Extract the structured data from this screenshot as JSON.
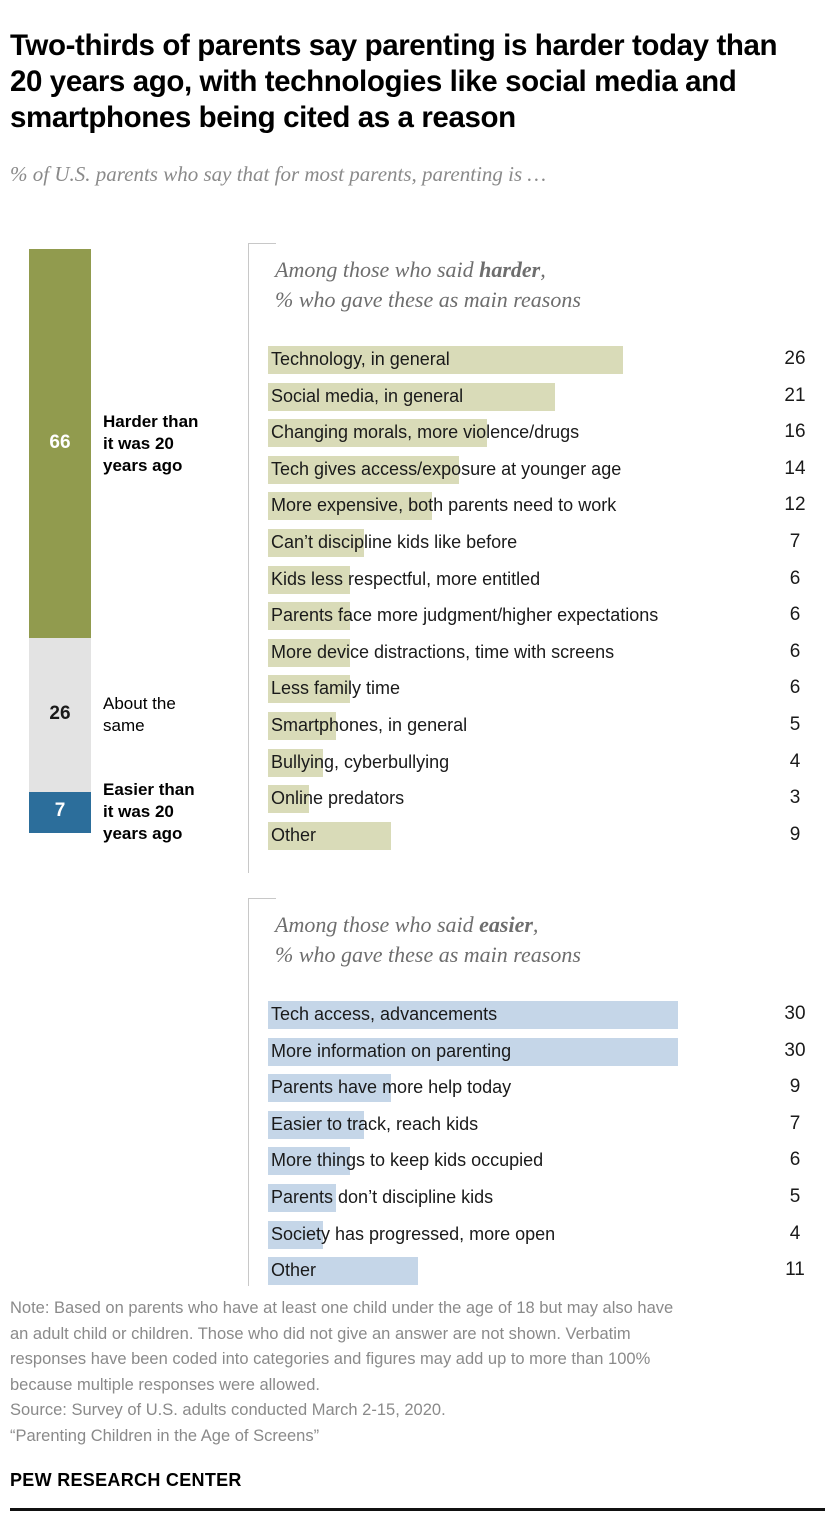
{
  "header": {
    "title": "Two-thirds of parents say parenting is harder today than 20 years ago, with technologies like social media and smartphones being cited as a reason",
    "subtitle": "% of U.S. parents who say that for most parents, parenting is …"
  },
  "footer": {
    "note_line1": "Note: Based on parents who have at least one child under the age of 18 but may also have",
    "note_line2": "an adult child or children. Those who did not give an answer are not shown. Verbatim",
    "note_line3": "responses have been coded into categories and figures may add up to more than 100%",
    "note_line4": "because multiple responses were allowed.",
    "source": "Source: Survey of U.S. adults conducted March 2-15, 2020.",
    "report": "“Parenting Children in the Age of Screens”",
    "org": "PEW RESEARCH CENTER"
  },
  "colors": {
    "harder": "#919b4e",
    "harder_light": "#d9dbb8",
    "same": "#e3e3e3",
    "easier": "#2c6e9b",
    "easier_light": "#c5d6e8",
    "note_text": "#8a8a8a"
  },
  "panels": {
    "harder_head_line1_pre": "Among those who said ",
    "harder_head_line1_bold": "harder",
    "harder_head_line1_post": ",",
    "harder_head_line2": "% who gave these as main reasons",
    "easier_head_line1_pre": "Among those who said ",
    "easier_head_line1_bold": "easier",
    "easier_head_line1_post": ",",
    "easier_head_line2": "% who gave these as main reasons"
  },
  "chart_data": {
    "type": "bar",
    "title": "Two-thirds of parents say parenting is harder today than 20 years ago, with technologies like social media and smartphones being cited as a reason",
    "subtitle": "% of U.S. parents who say that for most parents, parenting is …",
    "xlabel": "",
    "ylabel": "",
    "grid": false,
    "legend": "none",
    "stacked_bar": {
      "type": "bar",
      "orientation": "vertical-stacked",
      "categories": [
        "Harder than it was 20 years ago",
        "About the same",
        "Easier than it was 20 years ago"
      ],
      "values": [
        66,
        26,
        7
      ],
      "colors": [
        "#919b4e",
        "#e3e3e3",
        "#2c6e9b"
      ],
      "labels": [
        {
          "value": "66",
          "line1": "Harder than",
          "line2": "it was 20",
          "line3": "years ago",
          "bold": true
        },
        {
          "value": "26",
          "line1": "About the",
          "line2": "same",
          "line3": "",
          "bold": false
        },
        {
          "value": "7",
          "line1": "Easier than",
          "line2": "it was 20",
          "line3": "years ago",
          "bold": true
        }
      ]
    },
    "harder_reasons": {
      "type": "bar",
      "orientation": "horizontal",
      "title": "Among those who said harder, % who gave these as main reasons",
      "categories": [
        "Technology, in general",
        "Social media, in general",
        "Changing morals, more violence/drugs",
        "Tech gives access/exposure at younger age",
        "More expensive, both parents need to work",
        "Can’t discipline kids like before",
        "Kids less respectful, more entitled",
        "Parents face more judgment/higher expectations",
        "More device distractions, time with screens",
        "Less family time",
        "Smartphones, in general",
        "Bullying, cyberbullying",
        "Online predators",
        "Other"
      ],
      "values": [
        26,
        21,
        16,
        14,
        12,
        7,
        6,
        6,
        6,
        6,
        5,
        4,
        3,
        9
      ],
      "xlim": [
        0,
        30
      ],
      "color": "#d9dbb8"
    },
    "easier_reasons": {
      "type": "bar",
      "orientation": "horizontal",
      "title": "Among those who said easier, % who gave these as main reasons",
      "categories": [
        "Tech access, advancements",
        "More information on parenting",
        "Parents have more help today",
        "Easier to track, reach kids",
        "More things to keep kids occupied",
        "Parents don’t discipline kids",
        "Society has progressed, more open",
        "Other"
      ],
      "values": [
        30,
        30,
        9,
        7,
        6,
        5,
        4,
        11
      ],
      "xlim": [
        0,
        30
      ],
      "color": "#c5d6e8"
    }
  }
}
